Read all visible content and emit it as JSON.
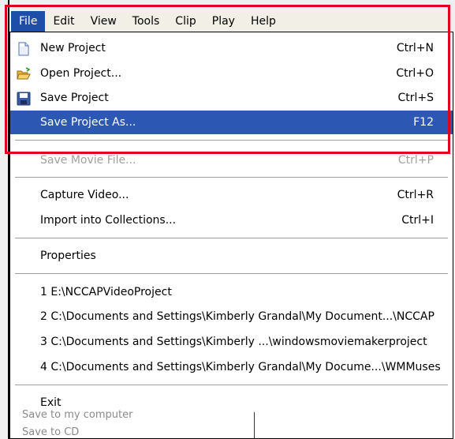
{
  "menubar": {
    "items": [
      "File",
      "Edit",
      "View",
      "Tools",
      "Clip",
      "Play",
      "Help"
    ],
    "active": "File"
  },
  "file_menu": {
    "new_project": {
      "label": "New Project",
      "shortcut": "Ctrl+N",
      "icon": "new-document-icon"
    },
    "open_project": {
      "label": "Open Project...",
      "shortcut": "Ctrl+O",
      "icon": "open-folder-icon"
    },
    "save_project": {
      "label": "Save Project",
      "shortcut": "Ctrl+S",
      "icon": "floppy-disk-icon"
    },
    "save_project_as": {
      "label": "Save Project As...",
      "shortcut": "F12"
    },
    "save_movie_file": {
      "label": "Save Movie File...",
      "shortcut": "Ctrl+P"
    },
    "capture_video": {
      "label": "Capture Video...",
      "shortcut": "Ctrl+R"
    },
    "import_collections": {
      "label": "Import into Collections...",
      "shortcut": "Ctrl+I"
    },
    "properties": {
      "label": "Properties"
    },
    "recent": [
      "1 E:\\NCCAPVideoProject",
      "2 C:\\Documents and Settings\\Kimberly Grandal\\My Document...\\NCCAP",
      "3 C:\\Documents and Settings\\Kimberly ...\\windowsmoviemakerproject",
      "4 C:\\Documents and Settings\\Kimberly Grandal\\My Docume...\\WMMuses"
    ],
    "exit": {
      "label": "Exit"
    }
  },
  "background_tasks": [
    "Save to my computer",
    "Save to CD"
  ],
  "colors": {
    "highlight": "#2c58b3",
    "menubar_active": "#1e4ea7",
    "annotation_box": "#e3001b"
  }
}
